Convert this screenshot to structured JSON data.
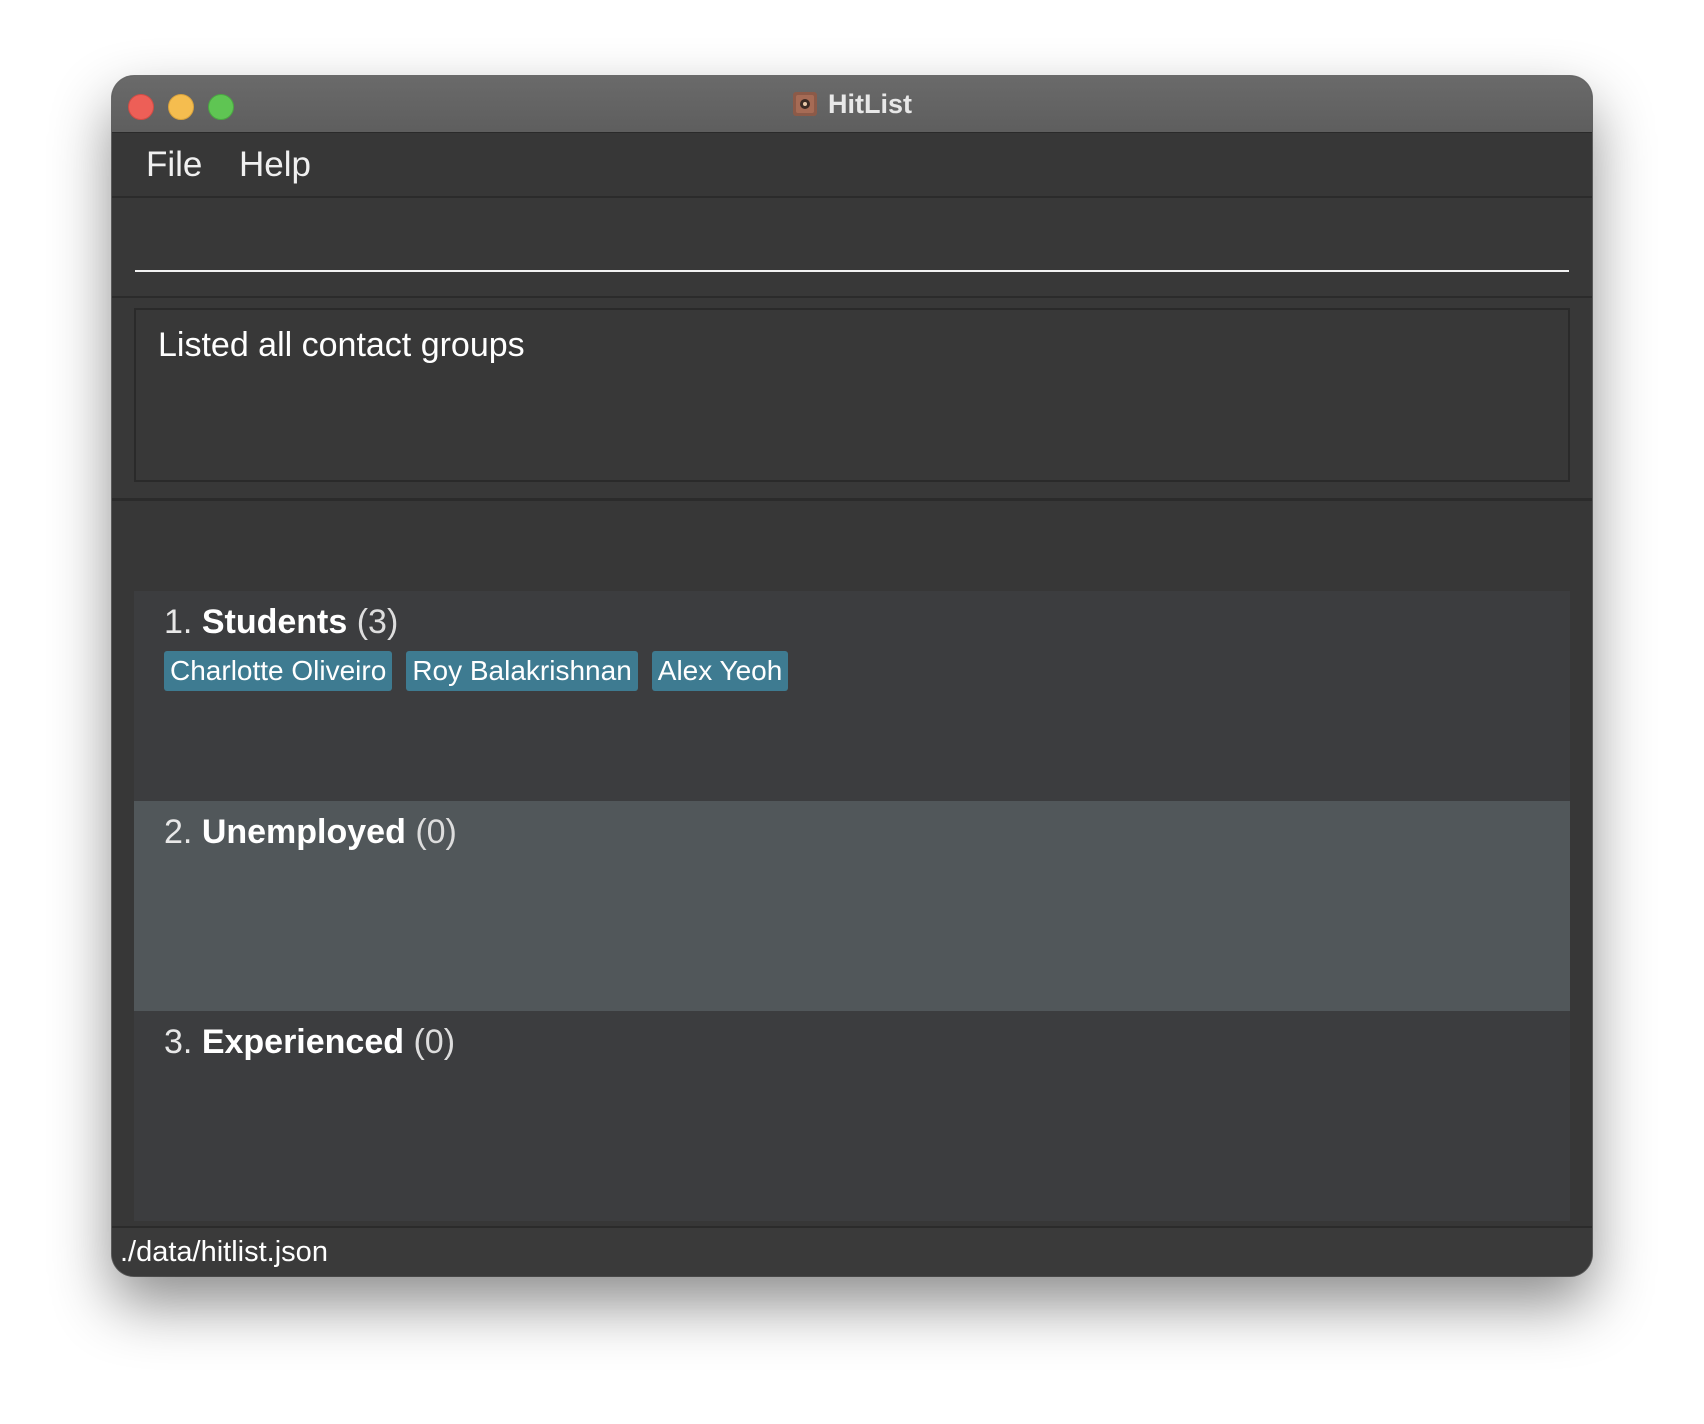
{
  "window": {
    "title": "HitList",
    "app_icon": "hitlist-app-icon"
  },
  "menu": {
    "file": "File",
    "help": "Help"
  },
  "command": {
    "value": "",
    "placeholder": ""
  },
  "result": {
    "message": "Listed all contact groups"
  },
  "groups": [
    {
      "index": "1.",
      "name": "Students",
      "count": "(3)",
      "members": [
        "Charlotte Oliveiro",
        "Roy Balakrishnan",
        "Alex Yeoh"
      ]
    },
    {
      "index": "2.",
      "name": "Unemployed",
      "count": "(0)",
      "members": []
    },
    {
      "index": "3.",
      "name": "Experienced",
      "count": "(0)",
      "members": []
    }
  ],
  "status": {
    "file_path": "./data/hitlist.json"
  },
  "colors": {
    "window_bg": "#373737",
    "tag_bg": "#3e7b91",
    "selected_card": "#51575a",
    "card": "#3c3d3f"
  }
}
